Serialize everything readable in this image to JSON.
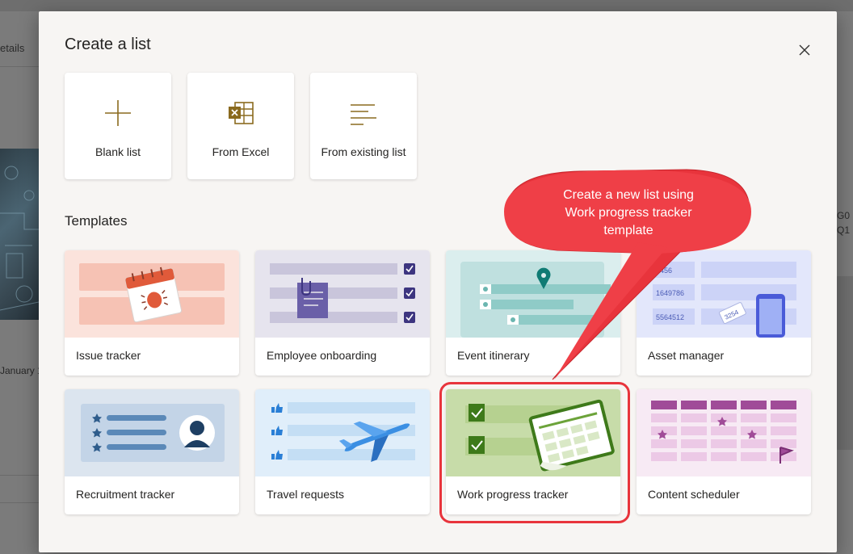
{
  "background_page": {
    "details_tab_fragment": "etails",
    "date_fragment": "January 1",
    "code_fragment_1": "G0",
    "code_fragment_2": "Q1"
  },
  "dialog": {
    "title": "Create a list",
    "close_icon": "close-icon",
    "start_options": [
      {
        "label": "Blank list",
        "icon": "plus-icon"
      },
      {
        "label": "From Excel",
        "icon": "excel-icon"
      },
      {
        "label": "From existing list",
        "icon": "list-lines-icon"
      }
    ],
    "templates_heading": "Templates",
    "templates": [
      {
        "label": "Issue tracker"
      },
      {
        "label": "Employee onboarding"
      },
      {
        "label": "Event itinerary"
      },
      {
        "label": "Asset manager",
        "thumb_numbers": [
          "4456",
          "1649786",
          "5564512",
          "3254"
        ]
      },
      {
        "label": "Recruitment tracker"
      },
      {
        "label": "Travel requests"
      },
      {
        "label": "Work progress tracker"
      },
      {
        "label": "Content scheduler"
      }
    ]
  },
  "callout": {
    "line1": "Create a new list using",
    "line2": "Work progress tracker",
    "line3": "template",
    "color": "#e8343c"
  },
  "colors": {
    "accent": "#8a6a1e",
    "highlight": "#e8343c"
  }
}
